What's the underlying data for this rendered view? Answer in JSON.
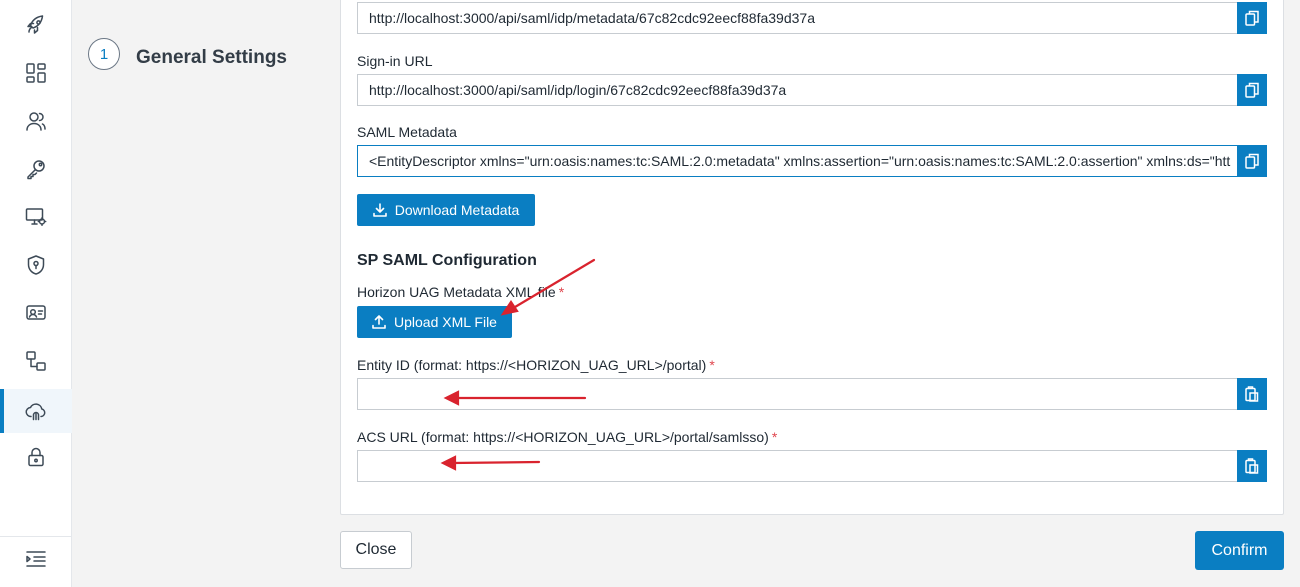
{
  "sidebar": {
    "items": [
      {
        "icon": "rocket-icon"
      },
      {
        "icon": "dashboard-icon"
      },
      {
        "icon": "users-icon"
      },
      {
        "icon": "key-icon"
      },
      {
        "icon": "monitor-settings-icon"
      },
      {
        "icon": "shield-icon"
      },
      {
        "icon": "id-card-icon"
      },
      {
        "icon": "workflow-icon"
      },
      {
        "icon": "cloud-fingerprint-icon",
        "active": true
      },
      {
        "icon": "lock-icon"
      }
    ],
    "collapse_icon": "menu-collapse-icon"
  },
  "step": {
    "number": "1",
    "title": "General Settings"
  },
  "form": {
    "metadata_url_value": "http://localhost:3000/api/saml/idp/metadata/67c82cdc92eecf88fa39d37a",
    "signin_url": {
      "label": "Sign-in URL",
      "value": "http://localhost:3000/api/saml/idp/login/67c82cdc92eecf88fa39d37a"
    },
    "saml_metadata": {
      "label": "SAML Metadata",
      "value": "<EntityDescriptor xmlns=\"urn:oasis:names:tc:SAML:2.0:metadata\" xmlns:assertion=\"urn:oasis:names:tc:SAML:2.0:assertion\" xmlns:ds=\"htt"
    },
    "download_button": "Download Metadata",
    "sp_section_title": "SP SAML Configuration",
    "horizon_metadata": {
      "label": "Horizon UAG Metadata XML file",
      "required": "*",
      "upload_button": "Upload XML File"
    },
    "entity_id": {
      "label": "Entity ID (format: https://<HORIZON_UAG_URL>/portal)",
      "required": "*",
      "value": ""
    },
    "acs_url": {
      "label": "ACS URL (format: https://<HORIZON_UAG_URL>/portal/samlsso)",
      "required": "*",
      "value": ""
    }
  },
  "footer": {
    "close_label": "Close",
    "confirm_label": "Confirm"
  },
  "colors": {
    "accent": "#0a7ec2",
    "required": "#e0464e",
    "annotation_arrow": "#d9232e"
  }
}
